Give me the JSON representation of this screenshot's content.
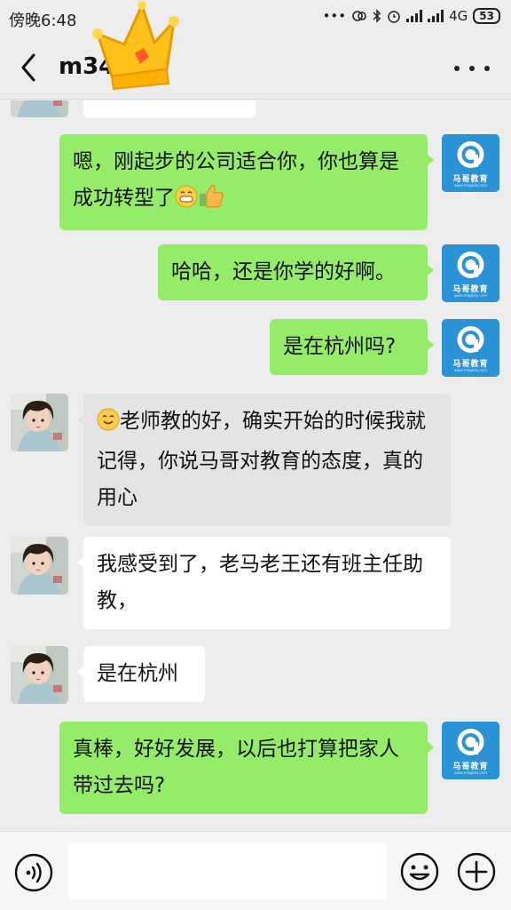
{
  "status_bar": {
    "time": "傍晚6:48",
    "network": "4G",
    "battery": "53"
  },
  "header": {
    "title": "m34",
    "back_icon": "chevron-left-icon",
    "more_icon": "more-dots-icon"
  },
  "contact_avatar": {
    "brand": "马哥教育",
    "sub": "www.magedu.com"
  },
  "messages": [
    {
      "from": "me",
      "text": "嗯，刚起步的公司适合你，你也算是成功转型了",
      "emojis": [
        "grin-emoji",
        "thumbs-up-emoji"
      ]
    },
    {
      "from": "me",
      "text": "哈哈，还是你学的好啊。"
    },
    {
      "from": "me",
      "text": "是在杭州吗?"
    },
    {
      "from": "other",
      "text": "老师教的好，确实开始的时候我就记得，你说马哥对教育的态度，真的用心",
      "emojis": [
        "smile-emoji"
      ]
    },
    {
      "from": "other",
      "text": "我感受到了，老马老王还有班主任助教，"
    },
    {
      "from": "other",
      "text": "是在杭州"
    },
    {
      "from": "me",
      "text": "真棒，好好发展，以后也打算把家人带过去吗?"
    }
  ],
  "input_bar": {
    "placeholder": "",
    "voice_icon": "voice-icon",
    "emoji_icon": "emoji-icon",
    "plus_icon": "plus-icon"
  }
}
